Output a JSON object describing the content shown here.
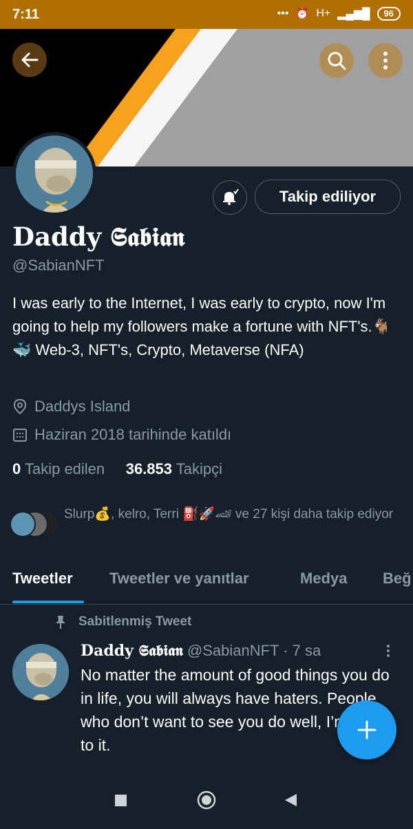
{
  "status_bar": {
    "time": "7:11",
    "dots": "•••",
    "network": "H+",
    "battery": "96"
  },
  "profile": {
    "display_name": "Daddy 𝕾𝖆𝖇𝖎𝖆𝖓",
    "handle": "@SabianNFT",
    "bio": "I was early to the Internet, I was early to crypto, now I'm going to help my followers make a fortune with NFT's.🐐🐳 Web-3, NFT's, Crypto, Metaverse (NFA)",
    "location": "Daddys Island",
    "joined": "Haziran 2018 tarihinde katıldı",
    "following_count": "0",
    "following_label": "Takip edilen",
    "followers_count": "36.853",
    "followers_label": "Takipçi",
    "follow_button": "Takip ediliyor",
    "followed_by_text": "Slurp💰, kelro, Terri ⛽🚀🏎 ve 27 kişi daha takip ediyor"
  },
  "tabs": [
    "Tweetler",
    "Tweetler ve yanıtlar",
    "Medya",
    "Beğ"
  ],
  "pinned_label": "Sabitlenmiş Tweet",
  "tweet": {
    "name": "Daddy 𝕾𝖆𝖇𝖎𝖆𝖓",
    "handle": "@SabianNFT",
    "time": "· 7 sa",
    "text": "No matter the amount of good things you do in life, you will always have haters. People who don’t want to see you do well, I’m used to it."
  },
  "colors": {
    "accent": "#1d9bf0",
    "background": "#15202b",
    "status_bar": "#b06f00",
    "muted": "#8b98a5"
  },
  "icons": [
    "back-arrow-icon",
    "search-icon",
    "more-vertical-icon",
    "notification-bell-icon",
    "location-pin-icon",
    "calendar-icon",
    "pin-icon",
    "plus-icon",
    "nav-square-icon",
    "nav-circle-icon",
    "nav-back-triangle-icon"
  ]
}
